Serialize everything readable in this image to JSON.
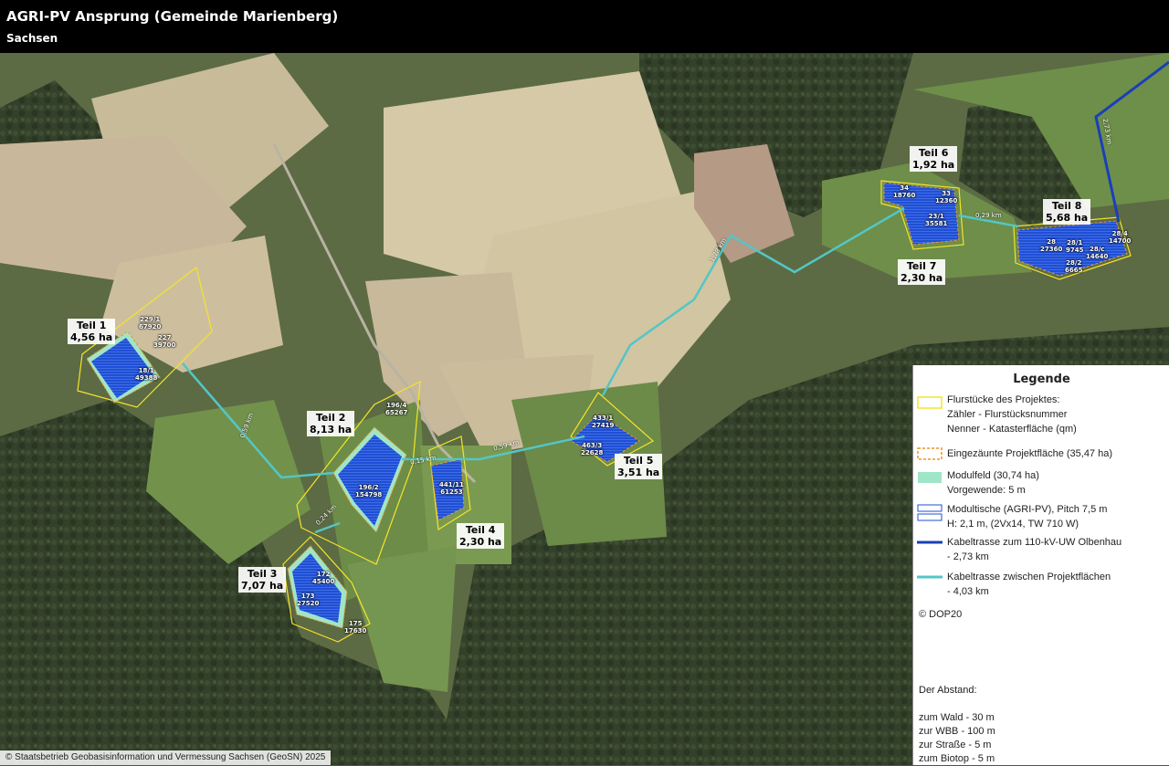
{
  "header": {
    "title": "AGRI-PV Ansprung (Gemeinde Marienberg)",
    "subtitle": "Sachsen"
  },
  "parts": [
    {
      "name": "Teil 1",
      "area": "4,56 ha"
    },
    {
      "name": "Teil 2",
      "area": "8,13 ha"
    },
    {
      "name": "Teil 3",
      "area": "7,07 ha"
    },
    {
      "name": "Teil 4",
      "area": "2,30 ha"
    },
    {
      "name": "Teil 5",
      "area": "3,51 ha"
    },
    {
      "name": "Teil 6",
      "area": "1,92 ha"
    },
    {
      "name": "Teil 7",
      "area": "2,30 ha"
    },
    {
      "name": "Teil 8",
      "area": "5,68 ha"
    }
  ],
  "parcels": [
    {
      "num": "229/1",
      "area": "67920"
    },
    {
      "num": "227",
      "area": "39700"
    },
    {
      "num": "18/1",
      "area": "49388"
    },
    {
      "num": "196/4",
      "area": "65267"
    },
    {
      "num": "196/2",
      "area": "154798"
    },
    {
      "num": "441/11",
      "area": "61253"
    },
    {
      "num": "172",
      "area": "45400"
    },
    {
      "num": "173",
      "area": "27520"
    },
    {
      "num": "175",
      "area": "17630"
    },
    {
      "num": "433/1",
      "area": "27419"
    },
    {
      "num": "463/3",
      "area": "22628"
    },
    {
      "num": "34",
      "area": "18760"
    },
    {
      "num": "33",
      "area": "12360"
    },
    {
      "num": "23/1",
      "area": "35581"
    },
    {
      "num": "28",
      "area": "27360"
    },
    {
      "num": "28/1",
      "area": "9745"
    },
    {
      "num": "28/c",
      "area": "14640"
    },
    {
      "num": "28/2",
      "area": "6665"
    },
    {
      "num": "28/4",
      "area": "14700"
    }
  ],
  "distances": [
    "0,59 km",
    "0,24 km",
    "0,15 km",
    "0,59 km",
    "1,78 km",
    "0,29 km",
    "2,73 km"
  ],
  "legend": {
    "title": "Legende",
    "items": [
      {
        "lines": [
          "Flurstücke des Projektes:",
          "Zähler - Flurstücksnummer",
          "Nenner - Katasterfläche (qm)"
        ]
      },
      {
        "lines": [
          "Eingezäunte Projektfläche (35,47 ha)"
        ]
      },
      {
        "lines": [
          "Modulfeld (30,74 ha)",
          "Vorgewende: 5 m"
        ]
      },
      {
        "lines": [
          "Modultische (AGRI-PV), Pitch 7,5 m",
          "H: 2,1 m, (2Vx14, TW 710 W)"
        ]
      },
      {
        "lines": [
          "Kabeltrasse zum 110-kV-UW Olbenhau",
          "- 2,73 km"
        ]
      },
      {
        "lines": [
          "Kabeltrasse zwischen Projektflächen",
          "- 4,03 km"
        ]
      }
    ],
    "source": "© DOP20",
    "distance_title": "Der Abstand:",
    "distances": [
      "zum Wald - 30 m",
      "zur WBB - 100 m",
      "zur Straße - 5 m",
      "zum Biotop - 5 m"
    ]
  },
  "copyright": "© Staatsbetrieb Geobasisinformation und Vermessung Sachsen (GeoSN) 2025",
  "colors": {
    "parcel_outline": "#f5e42a",
    "fence_outline": "#e8962a",
    "module_field": "#9fe6c9",
    "module_table": "#1f4fd6",
    "cable_uw": "#1a3fb8",
    "cable_between": "#53c6c6"
  }
}
